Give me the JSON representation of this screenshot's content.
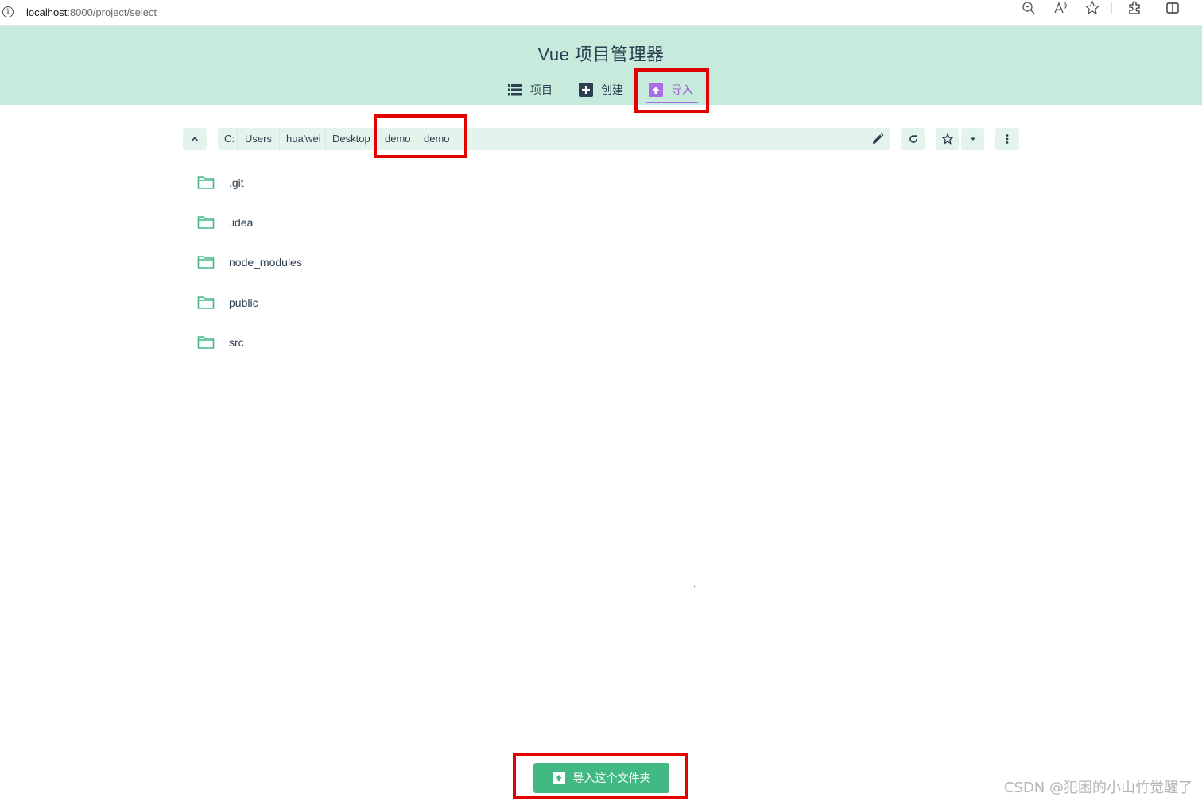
{
  "browser": {
    "info_glyph": "i",
    "url_host": "localhost",
    "url_rest": ":8000/project/select",
    "icons": [
      "zoom-out-icon",
      "read-aloud-icon",
      "favorite-star-icon",
      "extensions-icon",
      "split-screen-icon"
    ]
  },
  "header": {
    "title": "Vue 项目管理器",
    "tabs": [
      {
        "label": "项目",
        "icon": "list-icon"
      },
      {
        "label": "创建",
        "icon": "plus-box-icon"
      },
      {
        "label": "导入",
        "icon": "import-icon",
        "active": true
      }
    ]
  },
  "path": {
    "crumbs": [
      "C:",
      "Users",
      "hua'wei",
      "Desktop",
      "demo",
      "demo"
    ],
    "tools": [
      "folder-up-icon",
      "edit-path-icon",
      "refresh-icon",
      "favorite-icon",
      "favorites-dropdown-icon",
      "more-options-icon"
    ]
  },
  "folders": [
    ".git",
    ".idea",
    "node_modules",
    "public",
    "src"
  ],
  "actions": {
    "import_label": "导入这个文件夹"
  },
  "watermark": "CSDN @犯困的小山竹觉醒了",
  "colors": {
    "header_bg": "#c6ebdd",
    "accent_green": "#42b983",
    "active_tab": "#9a4fd6",
    "highlight_red": "#e30000",
    "toolbar_bg": "#e3f4ec"
  }
}
